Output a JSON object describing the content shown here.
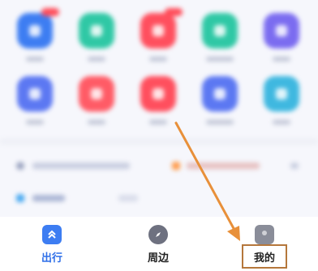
{
  "app_grid": {
    "rows": [
      [
        {
          "color": "#3d7df2",
          "badge": true
        },
        {
          "color": "#2fc8a5",
          "badge": false
        },
        {
          "color": "#ff4f5e",
          "badge": true
        },
        {
          "color": "#2fc8a5",
          "badge": false
        },
        {
          "color": "#7b6cf0",
          "badge": false
        }
      ],
      [
        {
          "color": "#5c78f2",
          "badge": false
        },
        {
          "color": "#ff5b66",
          "badge": false
        },
        {
          "color": "#ff4f5e",
          "badge": false
        },
        {
          "color": "#5c78f2",
          "badge": false
        },
        {
          "color": "#3fb8e0",
          "badge": false
        }
      ]
    ]
  },
  "tabbar": {
    "tabs": [
      {
        "label": "出行",
        "icon": "double-chevron-up-icon",
        "color": "#2f6fe8",
        "active": true
      },
      {
        "label": "周边",
        "icon": "compass-icon",
        "color": "#222222",
        "active": false
      },
      {
        "label": "我的",
        "icon": "profile-icon",
        "color": "#222222",
        "active": false
      }
    ]
  },
  "colors": {
    "arrow": "#e8903a",
    "highlight_box": "#b5773b",
    "accent_blue": "#2f6fe8"
  }
}
